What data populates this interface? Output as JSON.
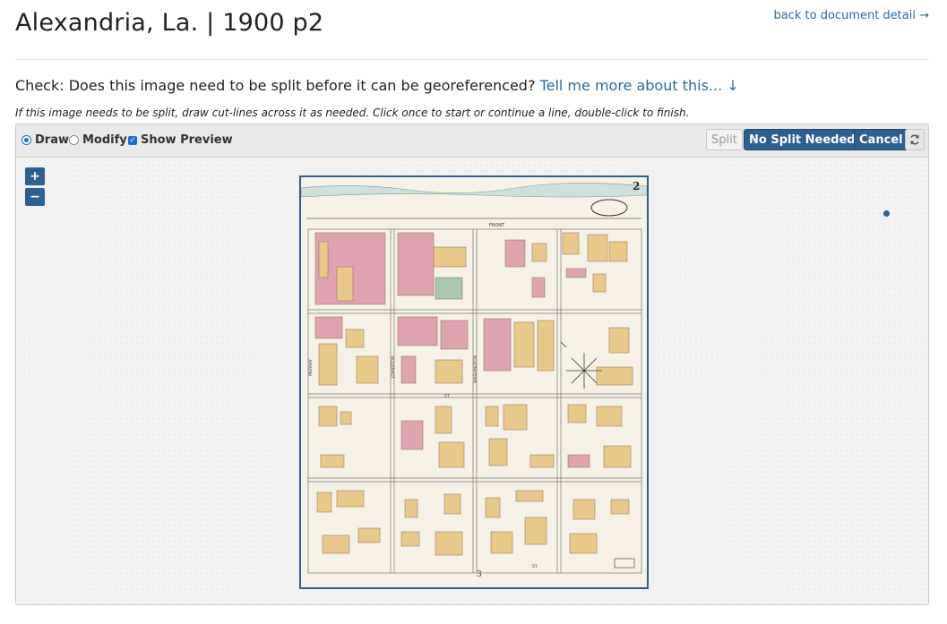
{
  "header": {
    "title": "Alexandria, La. | 1900 p2",
    "back_link": "back to document detail →"
  },
  "check": {
    "question": "Check: Does this image need to be split before it can be georeferenced?",
    "more_link": "Tell me more about this... ↓"
  },
  "hint": "If this image needs to be split, draw cut-lines across it as needed. Click once to start or continue a line, double-click to finish.",
  "toolbar": {
    "draw_label": "Draw",
    "modify_label": "Modify",
    "preview_label": "Show Preview",
    "split_label": "Split",
    "no_split_label": "No Split Needed",
    "cancel_label": "Cancel",
    "refresh_icon": "refresh-icon"
  },
  "map": {
    "zoom_in": "+",
    "zoom_out": "−",
    "sheet_number": "2",
    "bottom_number": "3",
    "street_labels": [
      "FRONT",
      "MURRAY",
      "JOHNSTON",
      "WASHINGTON",
      "ST.",
      "ST."
    ],
    "colors": {
      "accent": "#2d5f91",
      "link": "#2a6aa3",
      "paper": "#f6f1e6",
      "building_yellow": "#e9c98a",
      "building_pink": "#e0a3b2"
    }
  }
}
